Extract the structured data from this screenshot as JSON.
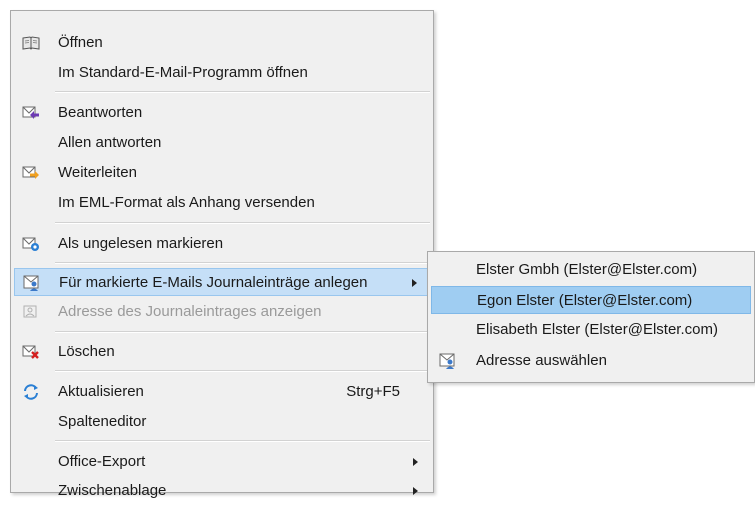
{
  "menu": {
    "items": [
      {
        "id": "open",
        "label": "Öffnen",
        "icon": "open-book-icon"
      },
      {
        "id": "open-default",
        "label": "Im Standard-E-Mail-Programm öffnen"
      },
      {
        "id": "reply",
        "label": "Beantworten",
        "icon": "reply-icon"
      },
      {
        "id": "reply-all",
        "label": "Allen antworten"
      },
      {
        "id": "forward",
        "label": "Weiterleiten",
        "icon": "forward-icon"
      },
      {
        "id": "send-eml",
        "label": "Im EML-Format als Anhang versenden"
      },
      {
        "id": "mark-unread",
        "label": "Als ungelesen markieren",
        "icon": "mark-unread-icon"
      },
      {
        "id": "journal",
        "label": "Für markierte E-Mails Journaleinträge anlegen",
        "icon": "journal-icon",
        "highlighted": true
      },
      {
        "id": "journal-address",
        "label": "Adresse des Journaleintrages anzeigen",
        "icon": "address-icon",
        "disabled": true
      },
      {
        "id": "delete",
        "label": "Löschen",
        "icon": "delete-icon"
      },
      {
        "id": "refresh",
        "label": "Aktualisieren",
        "shortcut": "Strg+F5",
        "icon": "refresh-icon"
      },
      {
        "id": "column-editor",
        "label": "Spalteneditor"
      },
      {
        "id": "office-export",
        "label": "Office-Export"
      },
      {
        "id": "clipboard",
        "label": "Zwischenablage"
      }
    ]
  },
  "submenu": {
    "items": [
      {
        "label": "Elster Gmbh (Elster@Elster.com)"
      },
      {
        "label": "Egon Elster (Elster@Elster.com)",
        "highlighted": true
      },
      {
        "label": "Elisabeth Elster (Elster@Elster.com)"
      },
      {
        "label": "Adresse auswählen",
        "icon": "address-select-icon"
      }
    ]
  },
  "colors": {
    "menu_bg": "#f0f0f0",
    "highlight": "#c5dff7",
    "submenu_highlight": "#9fcdf2",
    "disabled_text": "#9a9a9a"
  }
}
